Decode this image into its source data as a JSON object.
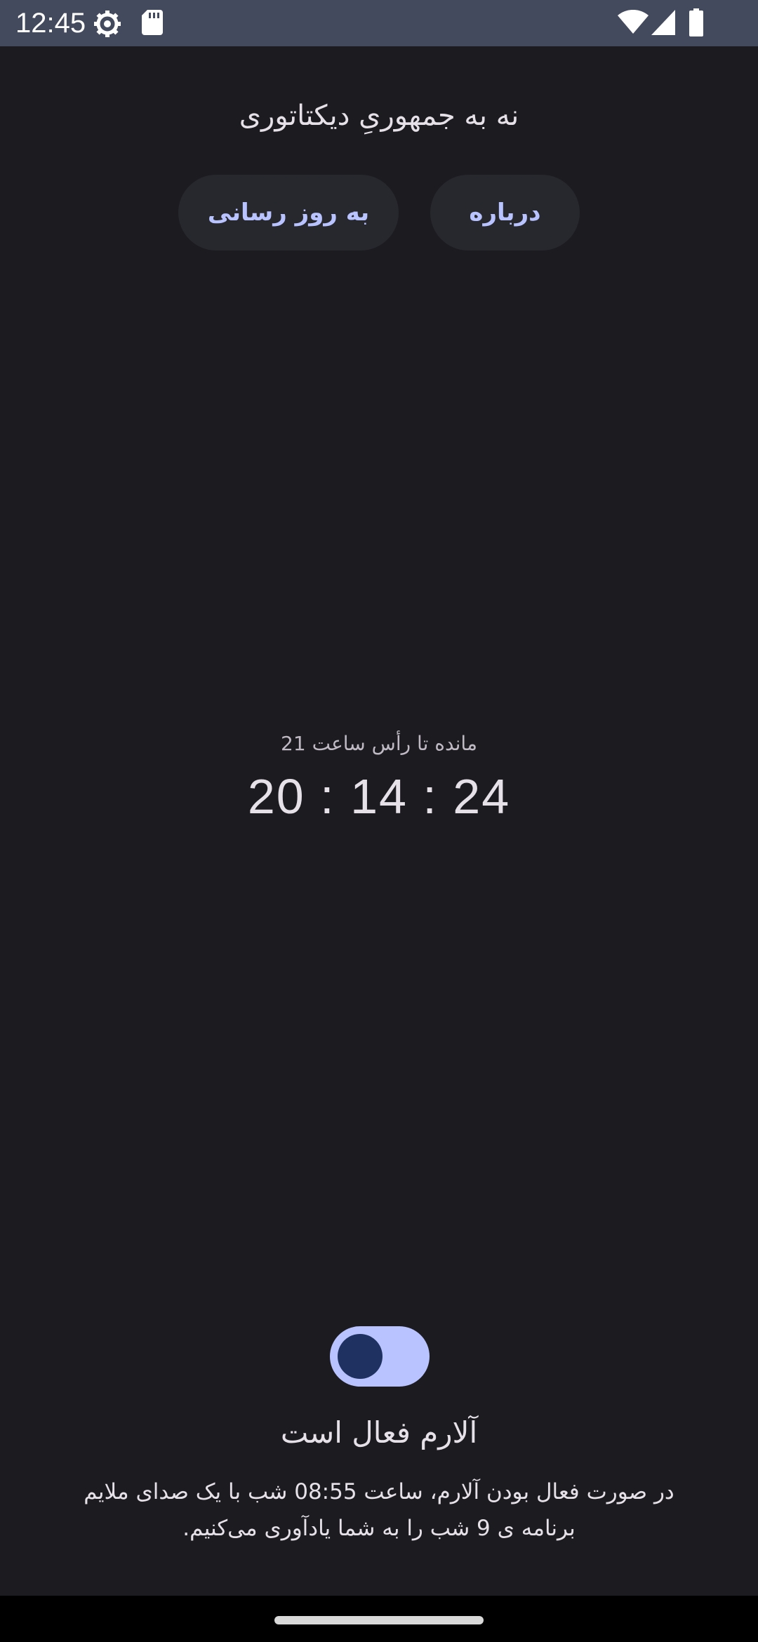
{
  "status_bar": {
    "time": "12:45",
    "icons": [
      "gear-icon",
      "sd-card-icon",
      "wifi-icon",
      "signal-icon",
      "battery-icon"
    ]
  },
  "header": {
    "title": "نه به جمهوریِ دیکتاتوری",
    "update_button_label": "به روز رسانی",
    "about_button_label": "درباره"
  },
  "countdown": {
    "label": "مانده تا رأس ساعت 21",
    "value": "20 : 14 : 24"
  },
  "alarm": {
    "enabled": true,
    "title": "آلارم فعال است",
    "description_line1": "در صورت فعال بودن آلارم، ساعت 08:55 شب با یک صدای ملایم",
    "description_line2": "برنامه ی 9 شب را به شما یادآوری می‌کنیم."
  },
  "colors": {
    "background": "#1c1b20",
    "status_bar": "#444a5d",
    "accent": "#b8c3ff",
    "button_bg": "#27272e",
    "toggle_thumb": "#1e3160"
  }
}
